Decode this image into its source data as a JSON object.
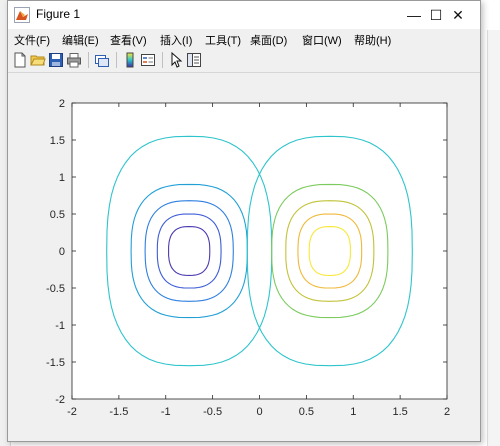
{
  "window": {
    "title": "Figure 1",
    "controls": {
      "minimize": "—",
      "maximize": "☐",
      "close": "✕"
    }
  },
  "menu": [
    {
      "label": "文件(F)"
    },
    {
      "label": "编辑(E)"
    },
    {
      "label": "查看(V)"
    },
    {
      "label": "插入(I)"
    },
    {
      "label": "工具(T)"
    },
    {
      "label": "桌面(D)"
    },
    {
      "label": "窗口(W)"
    },
    {
      "label": "帮助(H)"
    }
  ],
  "toolbar": [
    {
      "icon": "new-figure-icon"
    },
    {
      "icon": "open-file-icon"
    },
    {
      "icon": "save-icon"
    },
    {
      "icon": "print-icon"
    },
    {
      "icon": "link-plot-icon"
    },
    {
      "icon": "colorbar-icon"
    },
    {
      "icon": "legend-icon"
    },
    {
      "icon": "edit-plot-arrow-icon"
    },
    {
      "icon": "property-editor-icon"
    }
  ],
  "chart_data": {
    "type": "contour",
    "xlim": [
      -2,
      2
    ],
    "ylim": [
      -2,
      2
    ],
    "xticks": [
      "-2",
      "-1.5",
      "-1",
      "-0.5",
      "0",
      "0.5",
      "1",
      "1.5",
      "2"
    ],
    "yticks": [
      "2",
      "1.5",
      "1",
      "0.5",
      "0",
      "-0.5",
      "-1",
      "-1.5",
      "-2"
    ],
    "grid": false,
    "contours": [
      {
        "center": [
          -0.75,
          0
        ],
        "rx": 0.88,
        "ry": 1.55,
        "color": "#2ec4cc"
      },
      {
        "center": [
          -0.75,
          0
        ],
        "rx": 0.62,
        "ry": 0.9,
        "color": "#22a0d6"
      },
      {
        "center": [
          -0.75,
          0
        ],
        "rx": 0.47,
        "ry": 0.68,
        "color": "#2e7fe0"
      },
      {
        "center": [
          -0.75,
          0
        ],
        "rx": 0.34,
        "ry": 0.5,
        "color": "#3c5cd6"
      },
      {
        "center": [
          -0.75,
          0
        ],
        "rx": 0.22,
        "ry": 0.33,
        "color": "#4a3bb0"
      },
      {
        "center": [
          0.75,
          0
        ],
        "rx": 0.88,
        "ry": 1.55,
        "color": "#2ec4cc"
      },
      {
        "center": [
          0.75,
          0
        ],
        "rx": 0.62,
        "ry": 0.9,
        "color": "#7ccb5e"
      },
      {
        "center": [
          0.75,
          0
        ],
        "rx": 0.47,
        "ry": 0.68,
        "color": "#c2c23a"
      },
      {
        "center": [
          0.75,
          0
        ],
        "rx": 0.34,
        "ry": 0.5,
        "color": "#f0b83a"
      },
      {
        "center": [
          0.75,
          0
        ],
        "rx": 0.22,
        "ry": 0.33,
        "color": "#f7e83a"
      }
    ]
  },
  "colors": {
    "axes_bg": "#ffffff",
    "figure_bg": "#f0f0f0",
    "tick_color": "#262626"
  }
}
